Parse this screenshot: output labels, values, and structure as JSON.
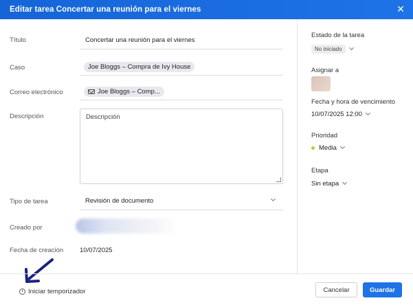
{
  "dialog": {
    "title": "Editar tarea Concertar una reunión para el viernes",
    "close_glyph": "✕"
  },
  "form": {
    "title_label": "Título",
    "title_value": "Concertar una reunión para el viernes",
    "case_label": "Caso",
    "case_value": "Joe Bloggs – Compra de Ivy House",
    "email_label": "Correo electrónico",
    "email_value": "Joe Bloggs – Comp...",
    "description_label": "Descripción",
    "description_placeholder": "Descripción",
    "task_type_label": "Tipo de tarea",
    "task_type_value": "Revisión de documento",
    "created_by_label": "Creado por",
    "created_date_label": "Fecha de creación",
    "created_date_value": "10/07/2025"
  },
  "sidebar": {
    "status_label": "Estado de la tarea",
    "status_value": "No iniciado",
    "assign_label": "Asignar a",
    "due_label": "Fecha y hora de vencimiento",
    "due_value": "10/07/2025 12:00",
    "priority_label": "Prioridad",
    "priority_value": "Media",
    "priority_color": "#a6d62b",
    "stage_label": "Etapa",
    "stage_value": "Sin etapa"
  },
  "footer": {
    "timer_label": "Iniciar temporizador",
    "cancel_label": "Cancelar",
    "save_label": "Guardar"
  },
  "colors": {
    "accent": "#1e73e6",
    "arrow": "#1a237e"
  }
}
